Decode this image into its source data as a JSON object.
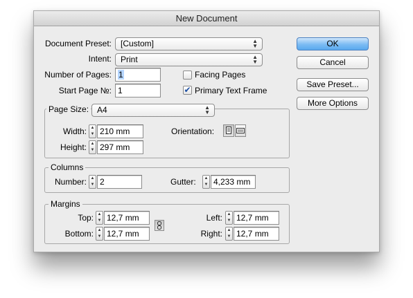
{
  "dialog": {
    "title": "New Document"
  },
  "document_preset": {
    "label": "Document Preset:",
    "value": "[Custom]"
  },
  "intent": {
    "label": "Intent:",
    "value": "Print"
  },
  "number_of_pages": {
    "label": "Number of Pages:",
    "value": "1"
  },
  "start_page": {
    "label": "Start Page №:",
    "value": "1"
  },
  "facing_pages": {
    "label": "Facing Pages",
    "checked": false
  },
  "primary_text_frame": {
    "label": "Primary Text Frame",
    "checked": true
  },
  "buttons": {
    "ok": "OK",
    "cancel": "Cancel",
    "save_preset": "Save Preset...",
    "more_options": "More Options"
  },
  "page_size": {
    "label": "Page Size:",
    "value": "A4",
    "width_label": "Width:",
    "width": "210 mm",
    "height_label": "Height:",
    "height": "297 mm",
    "orientation_label": "Orientation:",
    "orientation_selected": "portrait"
  },
  "columns": {
    "title": "Columns",
    "number_label": "Number:",
    "number": "2",
    "gutter_label": "Gutter:",
    "gutter": "4,233 mm"
  },
  "margins": {
    "title": "Margins",
    "top_label": "Top:",
    "top": "12,7 mm",
    "bottom_label": "Bottom:",
    "bottom": "12,7 mm",
    "left_label": "Left:",
    "left": "12,7 mm",
    "right_label": "Right:",
    "right": "12,7 mm"
  },
  "icons": {
    "stepper": "stepper-arrows-icon",
    "popup": "popup-arrows-icon",
    "portrait": "portrait-page-icon",
    "landscape": "landscape-page-icon",
    "chain": "chain-link-icon",
    "checkmark": "checkmark-icon"
  },
  "colors": {
    "dialog_bg": "#ececec",
    "primary_button": "#7bbbf3",
    "selection": "#b5d5ff"
  }
}
